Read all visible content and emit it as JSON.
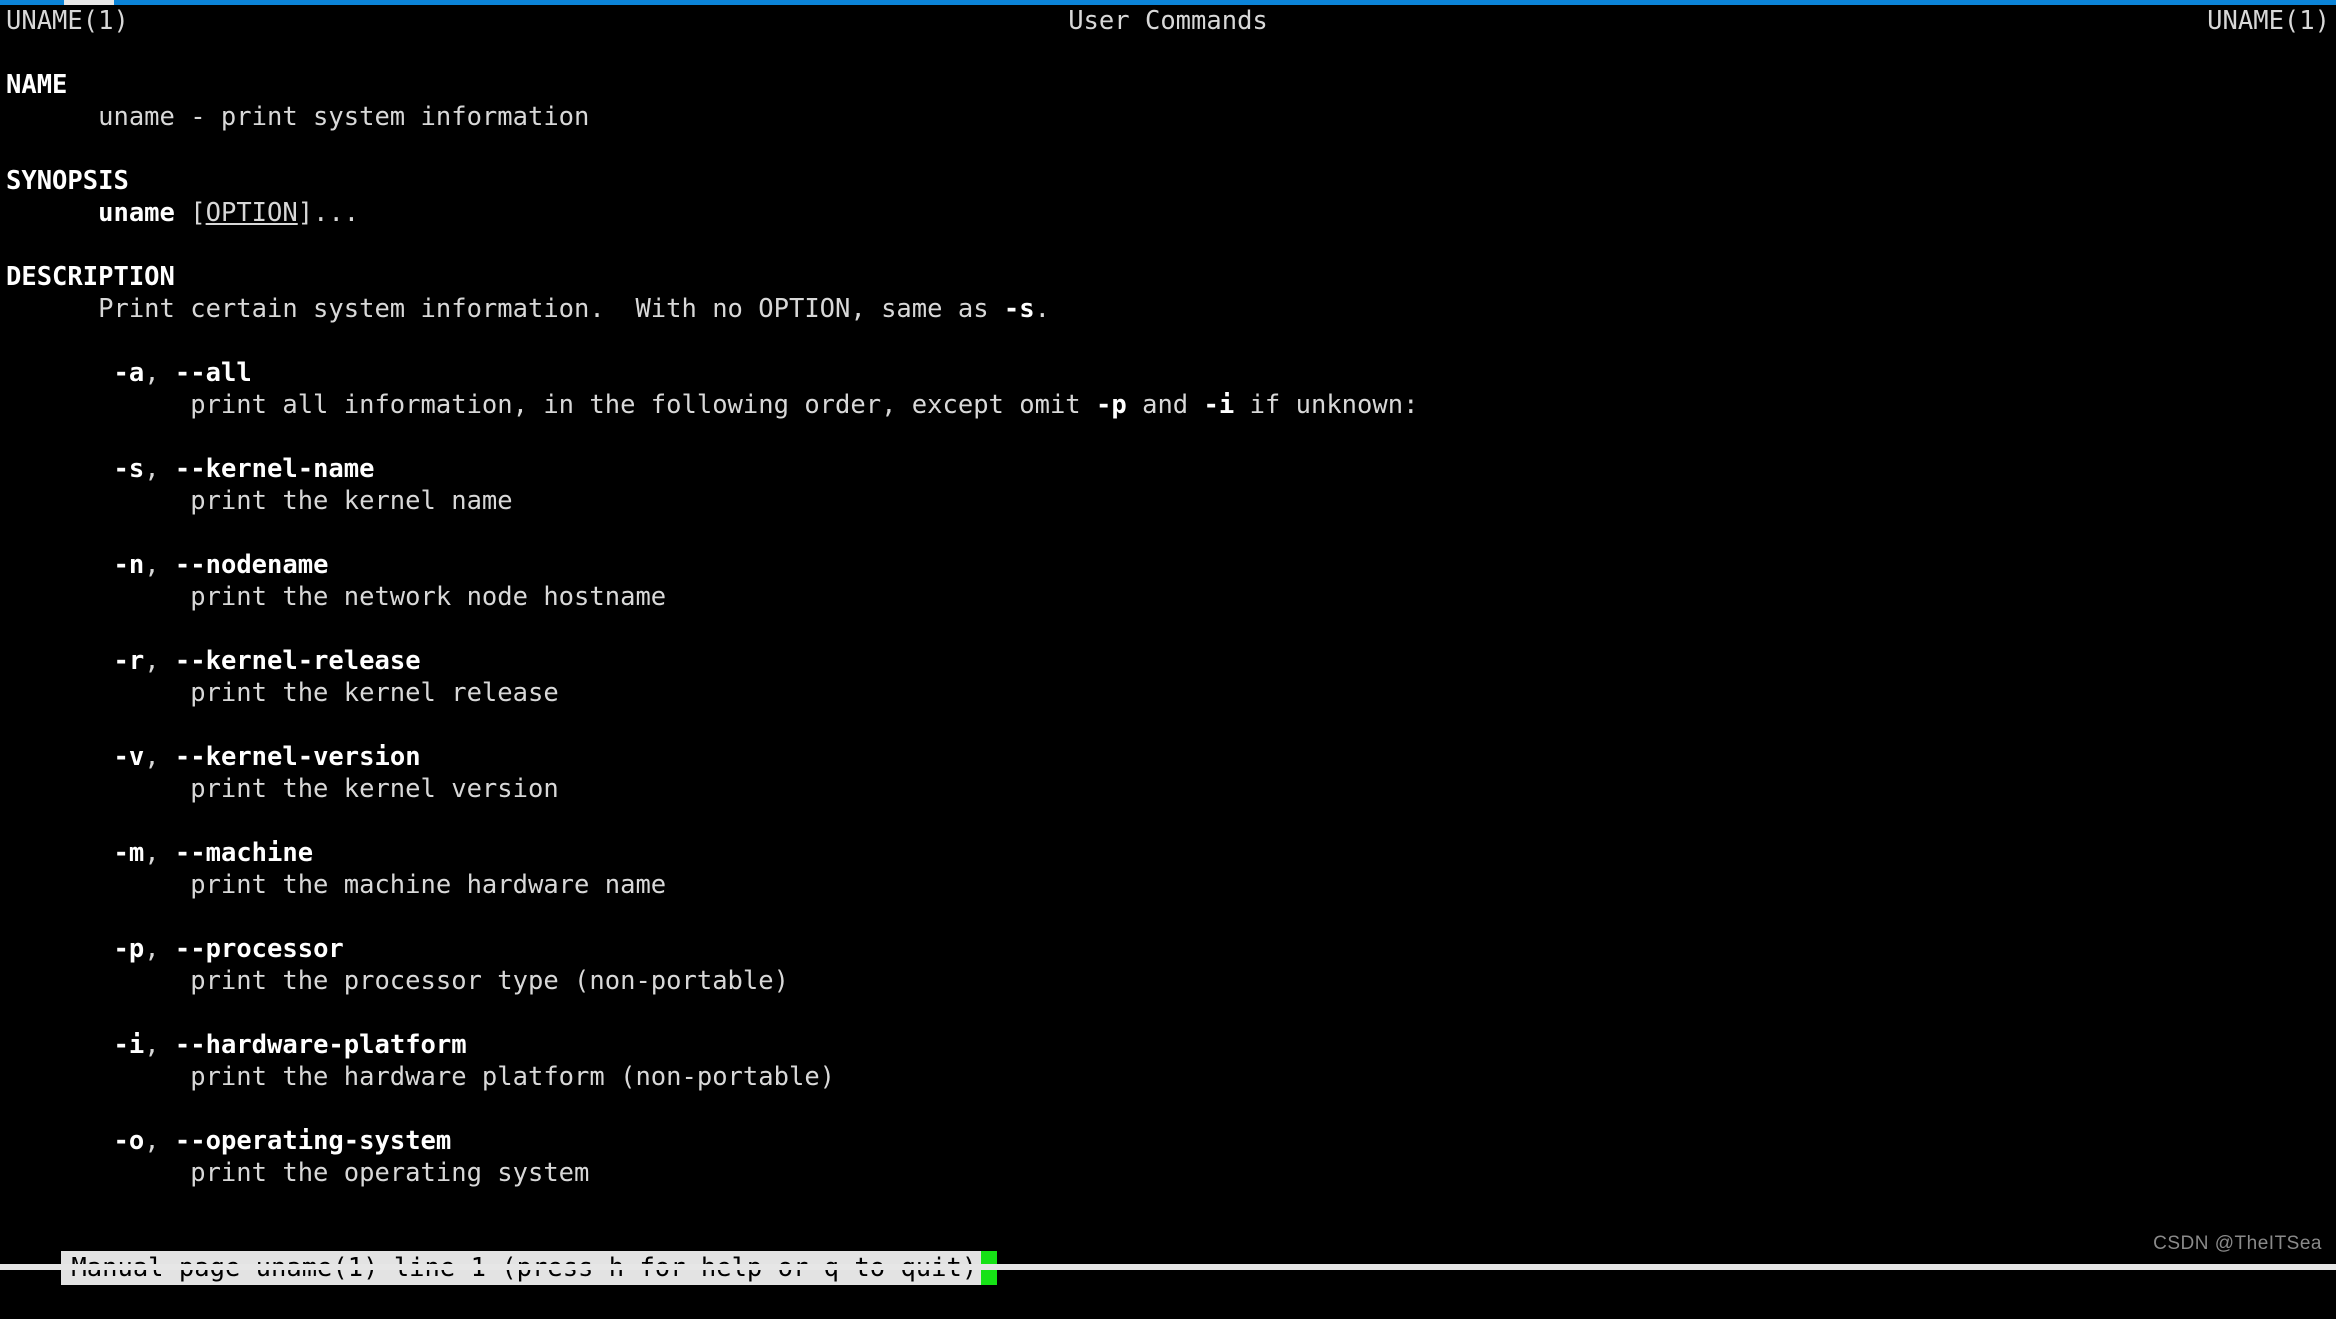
{
  "window": {
    "accent_color": "#0b84d8",
    "background_color": "#000000",
    "foreground_color": "#d8d8d8"
  },
  "man_header": {
    "left": "UNAME(1)",
    "center": "User Commands",
    "right": "UNAME(1)"
  },
  "sections": [
    {
      "name": "NAME",
      "heading": "NAME",
      "body": [
        "      uname - print system information"
      ]
    },
    {
      "name": "SYNOPSIS",
      "heading": "SYNOPSIS",
      "synopsis_indent": "      ",
      "synopsis_command": "uname",
      "synopsis_bracket_open": " [",
      "synopsis_option": "OPTION",
      "synopsis_tail": "]..."
    },
    {
      "name": "DESCRIPTION",
      "heading": "DESCRIPTION",
      "intro_prefix": "      Print certain system information.  With no OPTION, same as ",
      "intro_bold": "-s",
      "intro_suffix": "."
    }
  ],
  "options": [
    {
      "short": "-a",
      "sep": ", ",
      "long": "--all",
      "desc_prefix": "            print all information, in the following order, except omit ",
      "desc_bold_1": "-p",
      "desc_mid": " and ",
      "desc_bold_2": "-i",
      "desc_suffix": " if unknown:"
    },
    {
      "short": "-s",
      "sep": ", ",
      "long": "--kernel-name",
      "desc": "            print the kernel name"
    },
    {
      "short": "-n",
      "sep": ", ",
      "long": "--nodename",
      "desc": "            print the network node hostname"
    },
    {
      "short": "-r",
      "sep": ", ",
      "long": "--kernel-release",
      "desc": "            print the kernel release"
    },
    {
      "short": "-v",
      "sep": ", ",
      "long": "--kernel-version",
      "desc": "            print the kernel version"
    },
    {
      "short": "-m",
      "sep": ", ",
      "long": "--machine",
      "desc": "            print the machine hardware name"
    },
    {
      "short": "-p",
      "sep": ", ",
      "long": "--processor",
      "desc": "            print the processor type (non-portable)"
    },
    {
      "short": "-i",
      "sep": ", ",
      "long": "--hardware-platform",
      "desc": "            print the hardware platform (non-portable)"
    },
    {
      "short": "-o",
      "sep": ", ",
      "long": "--operating-system",
      "desc": "            print the operating system"
    }
  ],
  "option_indent": "       ",
  "status_bar": {
    "text": "Manual page uname(1) line 1 (press h for help or q to quit)",
    "cursor_color": "#16e216",
    "background_color": "#e3e3e3",
    "text_color": "#000000"
  },
  "watermark": {
    "text": "CSDN @TheITSea"
  }
}
